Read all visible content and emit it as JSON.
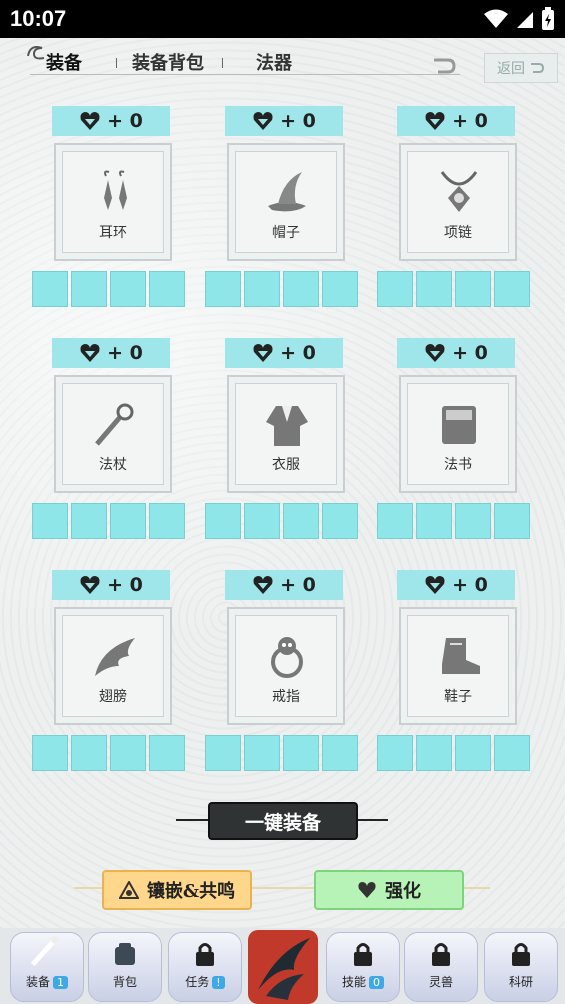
{
  "status": {
    "time": "10:07"
  },
  "tabs": {
    "equip": "装备",
    "bag": "装备背包",
    "artifact": "法器",
    "back": "返回"
  },
  "slots": [
    {
      "name": "耳环",
      "bonus": "+ 0",
      "icon": "earring-icon"
    },
    {
      "name": "帽子",
      "bonus": "+ 0",
      "icon": "hat-icon"
    },
    {
      "name": "项链",
      "bonus": "+ 0",
      "icon": "necklace-icon"
    },
    {
      "name": "法杖",
      "bonus": "+ 0",
      "icon": "staff-icon"
    },
    {
      "name": "衣服",
      "bonus": "+ 0",
      "icon": "robe-icon"
    },
    {
      "name": "法书",
      "bonus": "+ 0",
      "icon": "spellbook-icon"
    },
    {
      "name": "翅膀",
      "bonus": "+ 0",
      "icon": "wing-icon"
    },
    {
      "name": "戒指",
      "bonus": "+ 0",
      "icon": "ring-icon"
    },
    {
      "name": "鞋子",
      "bonus": "+ 0",
      "icon": "boots-icon"
    }
  ],
  "actions": {
    "one_key": "一键装备",
    "inlay": "镶嵌&共鸣",
    "strengthen": "强化"
  },
  "bottom": [
    {
      "label": "装备",
      "badge": "1"
    },
    {
      "label": "背包",
      "badge": ""
    },
    {
      "label": "任务",
      "badge": "!"
    },
    {
      "label": "技能",
      "badge": "0"
    },
    {
      "label": "灵兽",
      "badge": ""
    },
    {
      "label": "科研",
      "badge": ""
    }
  ]
}
